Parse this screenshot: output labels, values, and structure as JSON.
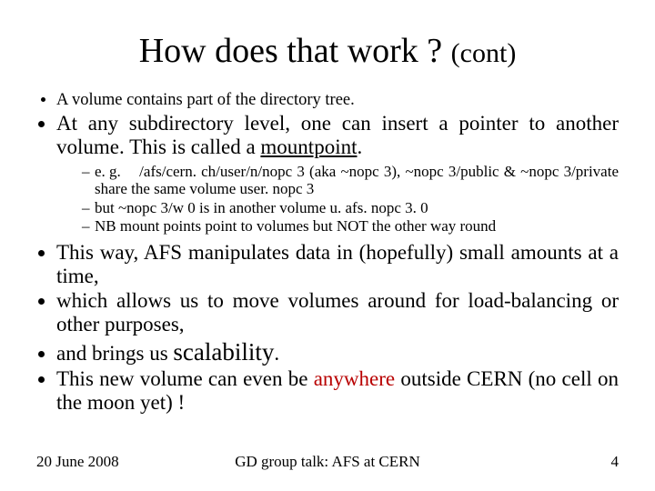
{
  "title_main": "How does that work ? ",
  "title_cont": "(cont)",
  "bullets": {
    "b1": "A volume contains part of the directory tree.",
    "b2_a": "At any subdirectory level, one can insert a pointer to another volume. This is called a ",
    "b2_mount": "mountpoint",
    "b2_b": ".",
    "s1_label": "e. g.",
    "s1_body": "/afs/cern. ch/user/n/nopc 3 (aka ~nopc 3), ~nopc 3/public & ~nopc 3/private share the same volume user. nopc 3",
    "s2": "but ~nopc 3/w 0 is in another volume u. afs. nopc 3. 0",
    "s3": "NB mount points point to volumes but NOT the other way round",
    "b3": "This way, AFS manipulates data in (hopefully) small amounts at a time,",
    "b4": "which allows us to move volumes around for load-balancing or other purposes,",
    "b5_a": "and brings us ",
    "b5_scal": "scalability",
    "b5_b": ".",
    "b6_a": "This new volume can even be ",
    "b6_anywhere": "anywhere",
    "b6_b": " outside CERN (no cell on the moon yet) !"
  },
  "footer": {
    "date": "20 June 2008",
    "center": "GD group talk: AFS at CERN",
    "page": "4"
  }
}
